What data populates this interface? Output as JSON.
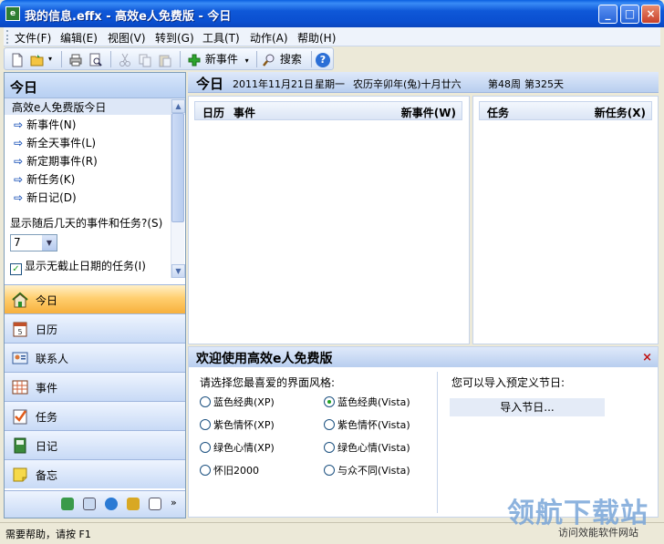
{
  "window": {
    "title": "我的信息.effx - 高效e人免费版 - 今日",
    "icon_label": "e",
    "minimize": "_",
    "maximize": "□",
    "close": "×"
  },
  "menu": [
    "文件(F)",
    "编辑(E)",
    "视图(V)",
    "转到(G)",
    "工具(T)",
    "动作(A)",
    "帮助(H)"
  ],
  "toolbar": {
    "new_event_label": "新事件",
    "search_label": "搜索",
    "help_label": "?",
    "dropdown_arrow": "▾"
  },
  "left_panel": {
    "header": "今日",
    "subheader": "高效e人免费版今日",
    "quick_items": [
      "新事件(N)",
      "新全天事件(L)",
      "新定期事件(R)",
      "新任务(K)",
      "新日记(D)"
    ],
    "days_question": "显示随后几天的事件和任务?(S)",
    "days_value": "7",
    "show_no_due_label": "显示无截止日期的任务(I)",
    "show_no_due_checked": true,
    "nav": [
      {
        "label": "今日",
        "icon": "home-icon",
        "active": true
      },
      {
        "label": "日历",
        "icon": "calendar-icon",
        "active": false
      },
      {
        "label": "联系人",
        "icon": "contact-card-icon",
        "active": false
      },
      {
        "label": "事件",
        "icon": "event-grid-icon",
        "active": false
      },
      {
        "label": "任务",
        "icon": "task-check-icon",
        "active": false
      },
      {
        "label": "日记",
        "icon": "journal-icon",
        "active": false
      },
      {
        "label": "备忘",
        "icon": "sticky-note-icon",
        "active": false
      }
    ]
  },
  "today_header": {
    "title": "今日",
    "date": "2011年11月21日",
    "weekday": "星期一",
    "lunar": "农历辛卯年(兔)十月廿六",
    "week": "第48周",
    "day_of_year": "第325天"
  },
  "calendar_pane": {
    "col1": "日历",
    "col2": "事件",
    "action": "新事件(W)"
  },
  "task_pane": {
    "col1": "任务",
    "action": "新任务(X)"
  },
  "welcome": {
    "title": "欢迎使用高效e人免费版",
    "close": "×",
    "style_prompt": "请选择您最喜爱的界面风格:",
    "styles_xp": [
      "蓝色经典(XP)",
      "紫色情怀(XP)",
      "绿色心情(XP)",
      "怀旧2000"
    ],
    "styles_vista": [
      "蓝色经典(Vista)",
      "紫色情怀(Vista)",
      "绿色心情(Vista)",
      "与众不同(Vista)"
    ],
    "selected_style": "蓝色经典(Vista)",
    "import_prompt": "您可以导入预定义节日:",
    "import_button": "导入节日..."
  },
  "statusbar": {
    "text": "需要帮助，请按 F1",
    "watermark": "领航下载站",
    "watermark_sub": "访问效能软件网站"
  },
  "colors": {
    "titlebar": "#0a58d8",
    "nav_active": "#f7b03c",
    "panel_header": "#b8ceef",
    "check_green": "#21a121",
    "close_red": "#c01010"
  }
}
